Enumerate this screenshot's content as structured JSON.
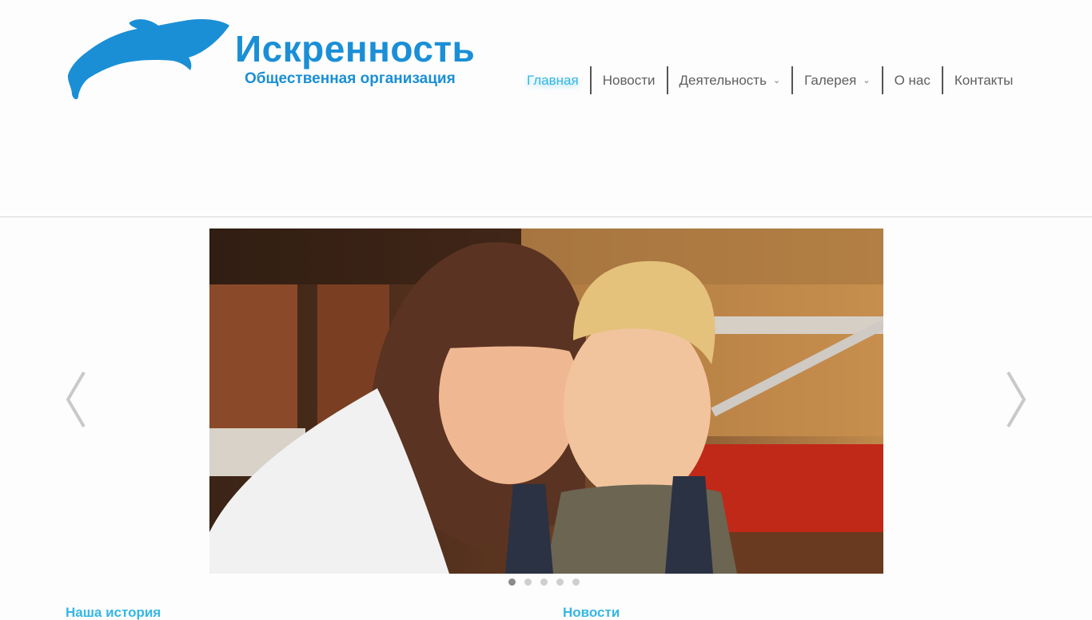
{
  "brand": {
    "title": "Искренность",
    "subtitle": "Общественная организация",
    "logo_icon": "dolphin-icon",
    "color": "#1a8fd6"
  },
  "nav": {
    "items": [
      {
        "label": "Главная",
        "active": true
      },
      {
        "label": "Новости"
      },
      {
        "label": "Деятельность",
        "has_dropdown": true
      },
      {
        "label": "Галерея",
        "has_dropdown": true
      },
      {
        "label": "О нас"
      },
      {
        "label": "Контакты"
      }
    ],
    "active_color": "#35b7e5",
    "dropdown_icon": "chevron-down-icon"
  },
  "slider": {
    "prev_icon": "chevron-left-icon",
    "next_icon": "chevron-right-icon",
    "dots_total": 5,
    "active_dot": 1,
    "image": "photo of a smiling girl hugging a boy"
  },
  "sections": {
    "left_heading": "Наша история",
    "right_heading": "Новости"
  }
}
